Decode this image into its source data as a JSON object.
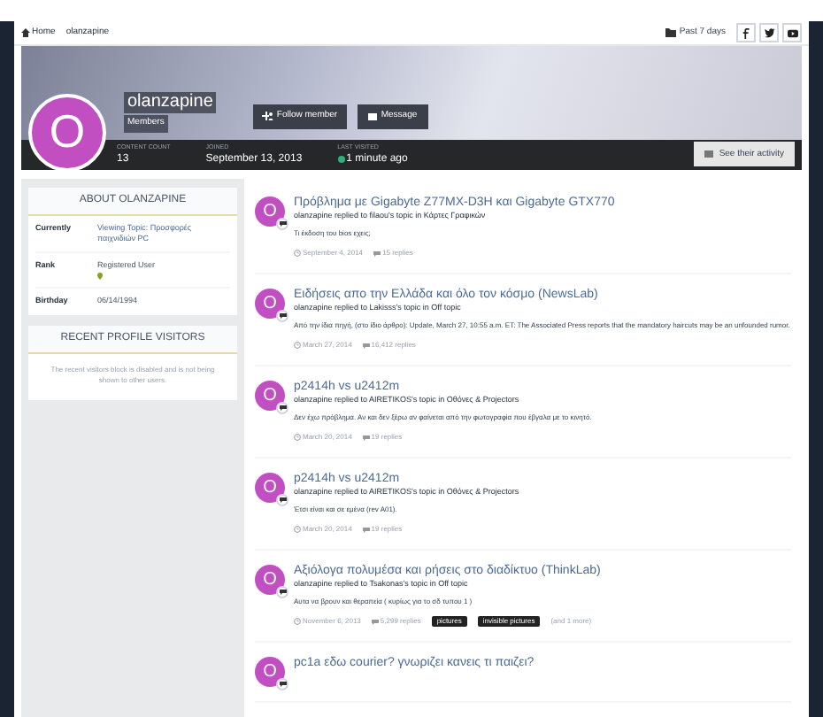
{
  "breadcrumb": [
    {
      "label": "Home"
    },
    {
      "label": "olanzapine"
    }
  ],
  "toolbar": {
    "past": "Past 7 days",
    "social": [
      {
        "kind": "facebook"
      },
      {
        "kind": "twitter"
      },
      {
        "kind": "youtube"
      }
    ]
  },
  "profile": {
    "name": "olanzapine",
    "group": "Members",
    "avatar_letter": "O",
    "follow": "Follow member",
    "message": "Message",
    "stats": [
      {
        "label": "CONTENT COUNT",
        "value": "13",
        "online": false
      },
      {
        "label": "JOINED",
        "value": "September 13, 2013",
        "online": false
      },
      {
        "label": "LAST VISITED",
        "value": "1 minute ago",
        "online": true
      }
    ],
    "activity": "See their activity"
  },
  "about": {
    "title": "ABOUT OLANZAPINE",
    "rows": [
      {
        "label": "Currently",
        "value": "Viewing Topic: Προσφορές παιχνιδιών PC",
        "link": true,
        "pin": false
      },
      {
        "label": "Rank",
        "value": "Registered User",
        "link": false,
        "pin": true
      },
      {
        "label": "Birthday",
        "value": "06/14/1994",
        "link": false,
        "pin": false
      }
    ]
  },
  "visitors": {
    "title": "RECENT PROFILE VISITORS",
    "text": "The recent visitors block is disabled and is not being shown to other users."
  },
  "posts": [
    {
      "avatar_letter": "O",
      "title": "Πρόβλημα με Gigabyte Z77MX-D3H και Gigabyte GTX770",
      "meta": "olanzapine replied to filaou's topic in Κάρτες Γραφικών",
      "body": "Τι έκδοση του bios εχεις;",
      "date": "September 4, 2014",
      "replies": "15 replies"
    },
    {
      "avatar_letter": "O",
      "title": "Ειδήσεις απο την Ελλάδα και όλο τον κόσμο (NewsLab)",
      "meta": "olanzapine replied to Lakisss's topic in Off topic",
      "body": "Από την ίδια πηγή, (στο ίδιο άρθρο): Update, March 27, 10:55 a.m. ET: The Associated Press reports that the mandatory haircuts may be an unfounded rumor.",
      "date": "March 27, 2014",
      "replies": "16,412 replies"
    },
    {
      "avatar_letter": "O",
      "title": "p2414h vs u2412m",
      "meta": "olanzapine replied to AIRETIKOS's topic in Οθόνες & Projectors",
      "body": "Δεν έχω πρόβλημα. Αν και δεν ξέρω αν φαίνεται από την φωτογραφία που έβγαλα με το κινητό.",
      "date": "March 20, 2014",
      "replies": "19 replies"
    },
    {
      "avatar_letter": "O",
      "title": "p2414h vs u2412m",
      "meta": "olanzapine replied to AIRETIKOS's topic in Οθόνες & Projectors",
      "body": "Έτσι είναι και σε εμένα (rev A01).",
      "date": "March 20, 2014",
      "replies": "19 replies"
    },
    {
      "avatar_letter": "O",
      "title": "Αξιόλογα πολυμέσα και ρήσεις στο διαδίκτυο (ThinkLab)",
      "meta": "olanzapine replied to Tsakonas's topic in Off topic",
      "body": "Αυτα να βρουν και θεραπεία ( κυρίως για το σδ τυπου 1 )",
      "date": "November 6, 2013",
      "replies": "5,299 replies",
      "tags": [
        "pictures",
        "invisible pictures"
      ],
      "more": "(and 1 more)"
    },
    {
      "avatar_letter": "O",
      "title": "pc1a εδω courier? γνωριζει κανεις τι παιζει?"
    }
  ]
}
